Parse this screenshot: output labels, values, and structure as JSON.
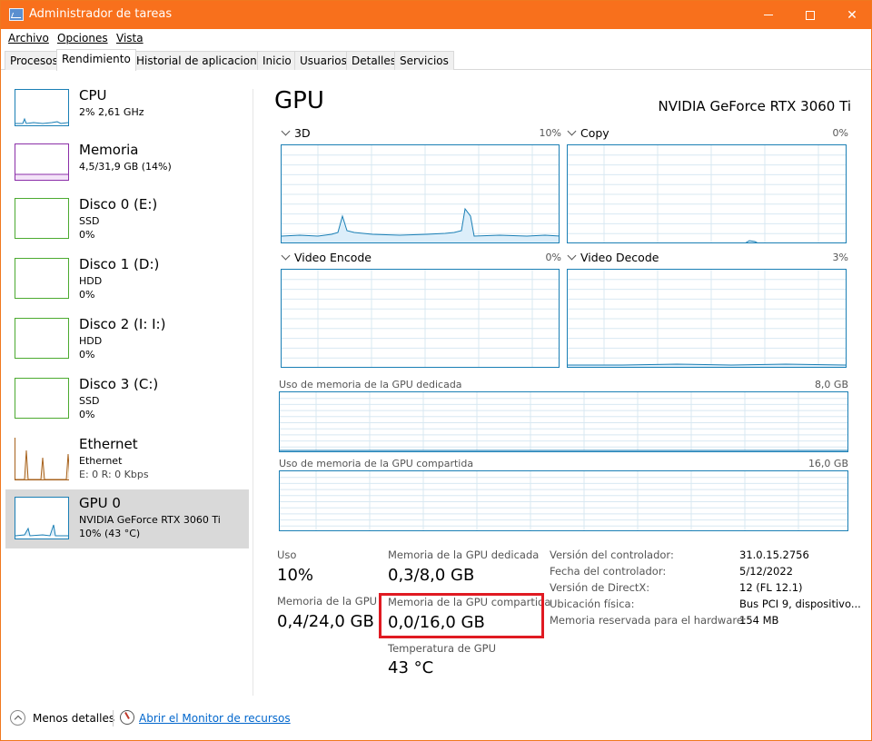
{
  "window": {
    "title": "Administrador de tareas",
    "titlebar_color": "#f8701c"
  },
  "menu": [
    "Archivo",
    "Opciones",
    "Vista"
  ],
  "tabs": [
    {
      "label": "Procesos",
      "active": false
    },
    {
      "label": "Rendimiento",
      "active": true
    },
    {
      "label": "Historial de aplicaciones",
      "active": false
    },
    {
      "label": "Inicio",
      "active": false
    },
    {
      "label": "Usuarios",
      "active": false
    },
    {
      "label": "Detalles",
      "active": false
    },
    {
      "label": "Servicios",
      "active": false
    }
  ],
  "sidebar": {
    "items": [
      {
        "title": "CPU",
        "line1": "2% 2,61 GHz",
        "line2": "",
        "color": "#1a7fb5",
        "selected": false
      },
      {
        "title": "Memoria",
        "line1": "4,5/31,9 GB (14%)",
        "line2": "",
        "color": "#8b2fa8",
        "selected": false
      },
      {
        "title": "Disco 0 (E:)",
        "line1": "SSD",
        "line2": "0%",
        "color": "#4caa30",
        "selected": false
      },
      {
        "title": "Disco 1 (D:)",
        "line1": "HDD",
        "line2": "0%",
        "color": "#4caa30",
        "selected": false
      },
      {
        "title": "Disco 2 (I: I:)",
        "line1": "HDD",
        "line2": "0%",
        "color": "#4caa30",
        "selected": false
      },
      {
        "title": "Disco 3 (C:)",
        "line1": "SSD",
        "line2": "0%",
        "color": "#4caa30",
        "selected": false
      },
      {
        "title": "Ethernet",
        "line1": "Ethernet",
        "line2": "E: 0 R: 0 Kbps",
        "color": "#a7621d",
        "selected": false
      },
      {
        "title": "GPU 0",
        "line1": "NVIDIA GeForce RTX 3060 Ti",
        "line2": "10% (43 °C)",
        "color": "#1a7fb5",
        "selected": true
      }
    ]
  },
  "main": {
    "title": "GPU",
    "model": "NVIDIA GeForce RTX 3060 Ti",
    "graphs": [
      {
        "label": "3D",
        "percent": "10%"
      },
      {
        "label": "Copy",
        "percent": "0%"
      },
      {
        "label": "Video Encode",
        "percent": "0%"
      },
      {
        "label": "Video Decode",
        "percent": "3%"
      }
    ],
    "dedicated_memory_graph": {
      "label": "Uso de memoria de la GPU dedicada",
      "max": "8,0 GB"
    },
    "shared_memory_graph": {
      "label": "Uso de memoria de la GPU compartida",
      "max": "16,0 GB"
    },
    "accent_color": "#1a7fb5",
    "highlight_color": "#e01a22"
  },
  "stats": {
    "uso_label": "Uso",
    "uso_value": "10%",
    "mem_gpu_label": "Memoria de la GPU",
    "mem_gpu_value": "0,4/24,0 GB",
    "dedicated_label": "Memoria de la GPU dedicada",
    "dedicated_value": "0,3/8,0 GB",
    "shared_label": "Memoria de la GPU compartida",
    "shared_value": "0,0/16,0 GB",
    "temp_label": "Temperatura de GPU",
    "temp_value": "43 °C"
  },
  "info": [
    {
      "key": "Versión del controlador:",
      "value": "31.0.15.2756"
    },
    {
      "key": "Fecha del controlador:",
      "value": "5/12/2022"
    },
    {
      "key": "Versión de DirectX:",
      "value": "12 (FL 12.1)"
    },
    {
      "key": "Ubicación física:",
      "value": "Bus PCI 9, dispositivo..."
    },
    {
      "key": "Memoria reservada para el hardware:",
      "value": "154 MB"
    }
  ],
  "footer": {
    "less_details": "Menos detalles",
    "monitor_link": "Abrir el Monitor de recursos"
  }
}
